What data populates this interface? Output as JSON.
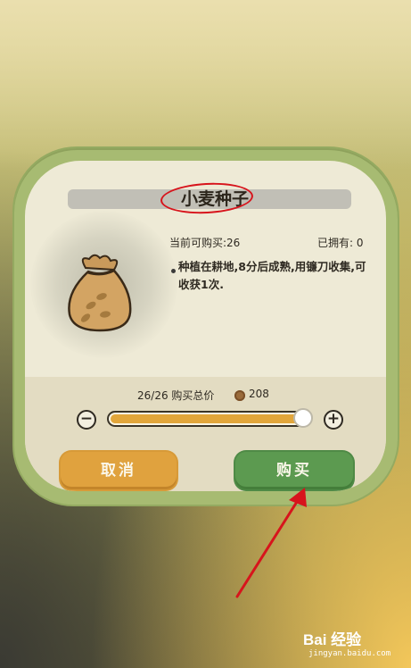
{
  "dialog": {
    "title": "小麦种子",
    "stock_label": "当前可购买:26",
    "owned_label": "已拥有: 0",
    "description": "种植在耕地,8分后成熟,用镰刀收集,可收获1次.",
    "item_icon": "seed-bag-icon"
  },
  "purchase": {
    "quantity_label": "26/26 购买总价",
    "total_price": "208",
    "currency_icon": "coin-icon",
    "slider_level": 1.0,
    "decrease_symbol": "−",
    "increase_symbol": "+"
  },
  "buttons": {
    "cancel_label": "取消",
    "buy_label": "购买"
  },
  "annotation": {
    "highlight_color": "#d7141c"
  },
  "watermark": {
    "brand": "Bai 经验",
    "url": "jingyan.baidu.com"
  }
}
